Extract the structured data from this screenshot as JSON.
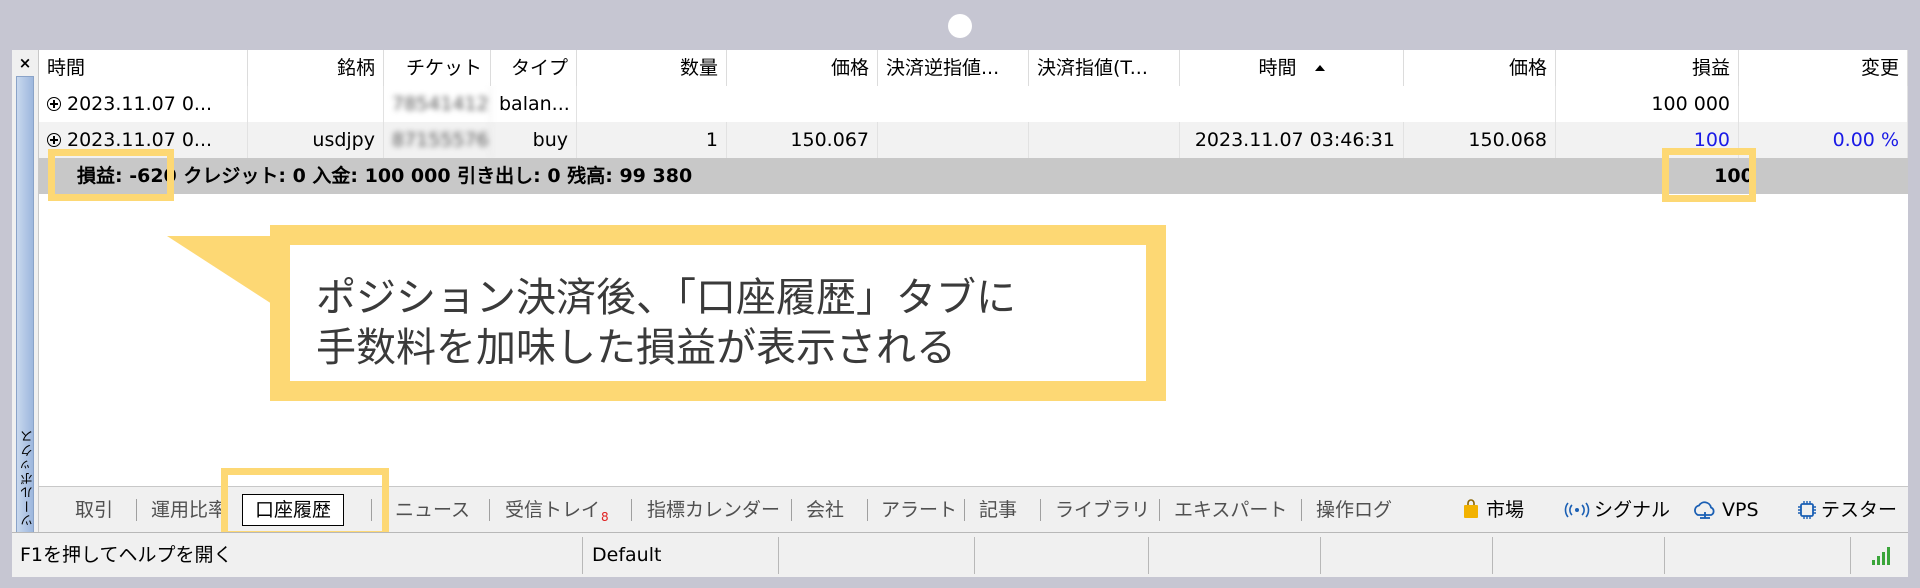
{
  "toolbox": {
    "close_label": "×",
    "label": "ツールボックス"
  },
  "table": {
    "headers": [
      "時間",
      "銘柄",
      "チケット",
      "タイプ",
      "数量",
      "価格",
      "決済逆指値...",
      "決済指値(T...",
      "時間",
      "価格",
      "損益",
      "変更"
    ],
    "rows": [
      {
        "time": "2023.11.07 0...",
        "symbol": "",
        "ticket": "78541412",
        "type": "balan...",
        "volume": "",
        "price": "",
        "sl": "",
        "tp": "",
        "close_time": "",
        "close_price": "",
        "profit": "100 000",
        "change": ""
      },
      {
        "time": "2023.11.07 0...",
        "symbol": "usdjpy",
        "ticket": "87155576",
        "type": "buy",
        "volume": "1",
        "price": "150.067",
        "sl": "",
        "tp": "",
        "close_time": "2023.11.07 03:46:31",
        "close_price": "150.068",
        "profit": "100",
        "change": "0.00 %"
      }
    ],
    "summary": {
      "text": "損益: -620  クレジット: 0  入金: 100 000  引き出し: 0  残高: 99 380",
      "total": "100"
    }
  },
  "callout": {
    "line1": "ポジション決済後、「口座履歴」タブに",
    "line2": "手数料を加味した損益が表示される"
  },
  "tabs": [
    {
      "label": "取引"
    },
    {
      "label": "運用比率"
    },
    {
      "label": "口座履歴",
      "active": true
    },
    {
      "label": "ニュース"
    },
    {
      "label": "受信トレイ",
      "badge": "8"
    },
    {
      "label": "指標カレンダー"
    },
    {
      "label": "会社"
    },
    {
      "label": "アラート"
    },
    {
      "label": "記事"
    },
    {
      "label": "ライブラリ"
    },
    {
      "label": "エキスパート"
    },
    {
      "label": "操作ログ"
    }
  ],
  "tools": [
    {
      "label": "市場",
      "icon": "shopping-bag-icon"
    },
    {
      "label": "シグナル",
      "icon": "signal-waves-icon"
    },
    {
      "label": "VPS",
      "icon": "cloud-icon"
    },
    {
      "label": "テスター",
      "icon": "chip-icon"
    }
  ],
  "status_bar": {
    "help_text": "F1を押してヘルプを開く",
    "profile": "Default"
  },
  "colors": {
    "highlight": "#fdd874",
    "profit_blue": "#1a1ae6",
    "summary_bg": "#c8c8c8"
  }
}
